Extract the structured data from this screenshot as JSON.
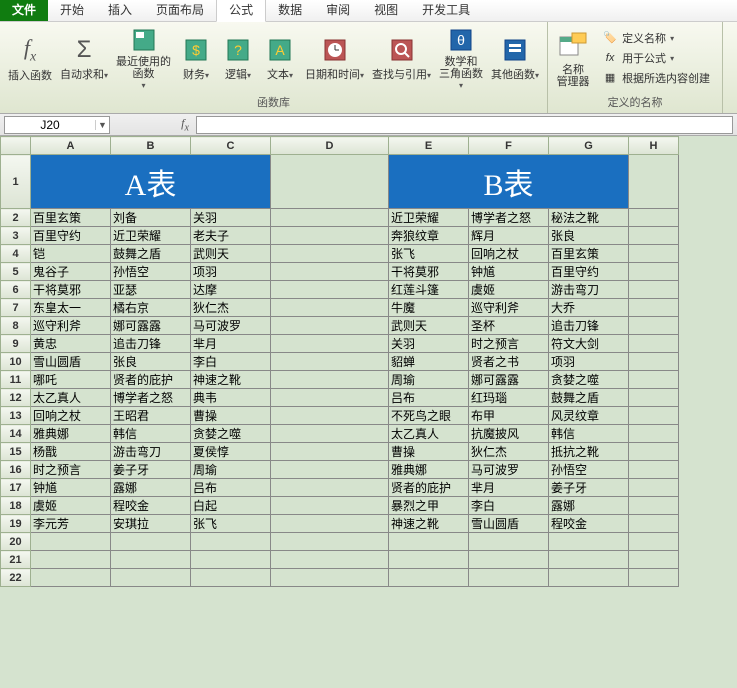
{
  "tabs": {
    "file": "文件",
    "items": [
      "开始",
      "插入",
      "页面布局",
      "公式",
      "数据",
      "审阅",
      "视图",
      "开发工具"
    ],
    "active": "公式"
  },
  "ribbon": {
    "insert_fn": "插入函数",
    "autosum": "自动求和",
    "recent": "最近使用的\n函数",
    "financial": "财务",
    "logical": "逻辑",
    "text": "文本",
    "datetime": "日期和时间",
    "lookup": "查找与引用",
    "math": "数学和\n三角函数",
    "more": "其他函数",
    "library_label": "函数库",
    "name_mgr": "名称\n管理器",
    "define_name": "定义名称",
    "use_in_formula": "用于公式",
    "create_from_sel": "根据所选内容创建",
    "defined_label": "定义的名称"
  },
  "namebox": "J20",
  "col_headers": [
    "A",
    "B",
    "C",
    "D",
    "E",
    "F",
    "G",
    "H"
  ],
  "titleA": "A表",
  "titleB": "B表",
  "tableA": [
    [
      "百里玄策",
      "刘备",
      "关羽"
    ],
    [
      "百里守约",
      "近卫荣耀",
      "老夫子"
    ],
    [
      "铠",
      "鼓舞之盾",
      "武则天"
    ],
    [
      "鬼谷子",
      "孙悟空",
      "项羽"
    ],
    [
      "干将莫邪",
      "亚瑟",
      "达摩"
    ],
    [
      "东皇太一",
      "橘右京",
      "狄仁杰"
    ],
    [
      "巡守利斧",
      "娜可露露",
      "马可波罗"
    ],
    [
      "黄忠",
      "追击刀锋",
      "芈月"
    ],
    [
      "雪山圆盾",
      "张良",
      "李白"
    ],
    [
      "哪吒",
      "贤者的庇护",
      "神速之靴"
    ],
    [
      "太乙真人",
      "博学者之怒",
      "典韦"
    ],
    [
      "回响之杖",
      "王昭君",
      "曹操"
    ],
    [
      "雅典娜",
      "韩信",
      "贪婪之噬"
    ],
    [
      "杨戬",
      "游击弯刀",
      "夏侯惇"
    ],
    [
      "时之预言",
      "姜子牙",
      "周瑜"
    ],
    [
      "钟馗",
      "露娜",
      "吕布"
    ],
    [
      "虞姬",
      "程咬金",
      "白起"
    ],
    [
      "李元芳",
      "安琪拉",
      "张飞"
    ]
  ],
  "tableB": [
    [
      "近卫荣耀",
      "博学者之怒",
      "秘法之靴"
    ],
    [
      "奔狼纹章",
      "辉月",
      "张良"
    ],
    [
      "张飞",
      "回响之杖",
      "百里玄策"
    ],
    [
      "干将莫邪",
      "钟馗",
      "百里守约"
    ],
    [
      "红莲斗篷",
      "虞姬",
      "游击弯刀"
    ],
    [
      "牛魔",
      "巡守利斧",
      "大乔"
    ],
    [
      "武则天",
      "圣杯",
      "追击刀锋"
    ],
    [
      "关羽",
      "时之预言",
      "符文大剑"
    ],
    [
      "貂蝉",
      "贤者之书",
      "项羽"
    ],
    [
      "周瑜",
      "娜可露露",
      "贪婪之噬"
    ],
    [
      "吕布",
      "红玛瑙",
      "鼓舞之盾"
    ],
    [
      "不死鸟之眼",
      "布甲",
      "风灵纹章"
    ],
    [
      "太乙真人",
      "抗魔披风",
      "韩信"
    ],
    [
      "曹操",
      "狄仁杰",
      "抵抗之靴"
    ],
    [
      "雅典娜",
      "马可波罗",
      "孙悟空"
    ],
    [
      "贤者的庇护",
      "芈月",
      "姜子牙"
    ],
    [
      "暴烈之甲",
      "李白",
      "露娜"
    ],
    [
      "神速之靴",
      "雪山圆盾",
      "程咬金"
    ]
  ],
  "row_count": 22
}
